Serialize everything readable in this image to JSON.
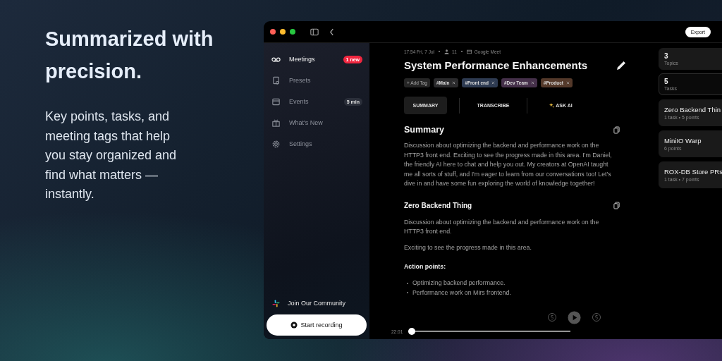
{
  "intro": {
    "headline": "Summarized with precision.",
    "body": "Key points, tasks, and meeting tags that help you stay organized and find what matters — instantly."
  },
  "window": {
    "export_button": "Export"
  },
  "sidebar": {
    "items": [
      {
        "label": "Meetings",
        "selected": true,
        "badge": {
          "text": "1 new",
          "kind": "alert"
        }
      },
      {
        "label": "Presets",
        "selected": false
      },
      {
        "label": "Events",
        "selected": false,
        "badge": {
          "text": "5 min",
          "kind": "neutral"
        }
      },
      {
        "label": "What's New",
        "selected": false
      },
      {
        "label": "Settings",
        "selected": false
      }
    ],
    "community_link": "Join Our Community",
    "record_button": "Start recording"
  },
  "meeting": {
    "time": "17:54 Fri, 7 Jul",
    "participants": "11",
    "platform": "Google Meet",
    "title": "System Performance Enhancements",
    "add_tag": "+ Add Tag",
    "tags": [
      {
        "label": "#Main",
        "color": "#2a2a2c"
      },
      {
        "label": "#Front end",
        "color": "#2e3b52"
      },
      {
        "label": "#Dev Team",
        "color": "#45304a"
      },
      {
        "label": "#Product",
        "color": "#54392a"
      }
    ],
    "tabs": [
      {
        "label": "SUMMARY",
        "selected": true
      },
      {
        "label": "TRANSCRIBE",
        "selected": false
      },
      {
        "label": "ASK AI",
        "selected": false
      }
    ],
    "summary": {
      "heading": "Summary",
      "text": "Discussion about optimizing the backend and performance work on the HTTP3 front end. Exciting to see the progress made in this area. I'm Daniel, the friendly AI here to chat and help you out. My creators at OpenAI taught me all sorts of stuff, and I'm eager to learn from our conversations too! Let's dive in and have some fun exploring the world of knowledge together!"
    },
    "topic": {
      "heading": "Zero Backend Thing",
      "paragraphs": [
        "Discussion about optimizing the backend and performance work on the HTTP3 front end.",
        "Exciting to see the progress made in this area."
      ],
      "action_heading": "Action points:",
      "actions": [
        "Optimizing backend performance.",
        "Performance work on Mirs frontend."
      ]
    },
    "player": {
      "time": "22:01",
      "level": 0
    }
  },
  "stats": [
    {
      "value": "3",
      "label": "Topics",
      "selected": false
    },
    {
      "value": "5",
      "label": "Tasks",
      "selected": true
    }
  ],
  "topics": [
    {
      "title": "Zero Backend Thin",
      "detail": "1 task • 5 points"
    },
    {
      "title": "MiniIO Warp",
      "detail": "6 points"
    },
    {
      "title": "ROX-DB Store PRs",
      "detail": "1 task • 7 points"
    }
  ]
}
